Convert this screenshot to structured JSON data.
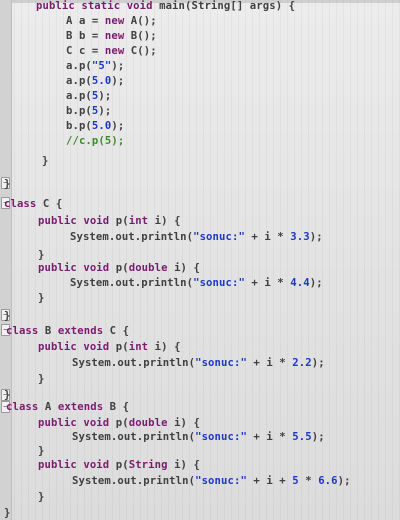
{
  "editor": {
    "lines": [
      {
        "tokens": [
          {
            "t": "public static void ",
            "c": "kw"
          },
          {
            "t": "main(String[] args) {",
            "c": "plain"
          }
        ]
      },
      {
        "tokens": [
          {
            "t": "A a = ",
            "c": "plain"
          },
          {
            "t": "new ",
            "c": "kw"
          },
          {
            "t": "A();",
            "c": "plain"
          }
        ]
      },
      {
        "tokens": [
          {
            "t": "B b = ",
            "c": "plain"
          },
          {
            "t": "new ",
            "c": "kw"
          },
          {
            "t": "B();",
            "c": "plain"
          }
        ]
      },
      {
        "tokens": [
          {
            "t": "C c = ",
            "c": "plain"
          },
          {
            "t": "new ",
            "c": "kw"
          },
          {
            "t": "C();",
            "c": "plain"
          }
        ]
      },
      {
        "tokens": [
          {
            "t": "a.p(",
            "c": "plain"
          },
          {
            "t": "\"5\"",
            "c": "str"
          },
          {
            "t": ");",
            "c": "plain"
          }
        ]
      },
      {
        "tokens": [
          {
            "t": "a.p(",
            "c": "plain"
          },
          {
            "t": "5.0",
            "c": "num"
          },
          {
            "t": ");",
            "c": "plain"
          }
        ]
      },
      {
        "tokens": [
          {
            "t": "a.p(",
            "c": "plain"
          },
          {
            "t": "5",
            "c": "num"
          },
          {
            "t": ");",
            "c": "plain"
          }
        ]
      },
      {
        "tokens": [
          {
            "t": "b.p(",
            "c": "plain"
          },
          {
            "t": "5",
            "c": "num"
          },
          {
            "t": ");",
            "c": "plain"
          }
        ]
      },
      {
        "tokens": [
          {
            "t": "b.p(",
            "c": "plain"
          },
          {
            "t": "5.0",
            "c": "num"
          },
          {
            "t": ");",
            "c": "plain"
          }
        ]
      },
      {
        "tokens": [
          {
            "t": "//c.p(5);",
            "c": "cmt"
          }
        ]
      },
      {
        "tokens": [
          {
            "t": "}",
            "c": "plain"
          }
        ]
      },
      {
        "tokens": [
          {
            "t": "}",
            "c": "plain"
          }
        ]
      },
      {
        "tokens": [
          {
            "t": "class ",
            "c": "kw"
          },
          {
            "t": "C {",
            "c": "plain"
          }
        ]
      },
      {
        "tokens": [
          {
            "t": "public void ",
            "c": "kw"
          },
          {
            "t": "p(",
            "c": "plain"
          },
          {
            "t": "int ",
            "c": "kw"
          },
          {
            "t": "i) {",
            "c": "plain"
          }
        ]
      },
      {
        "tokens": [
          {
            "t": "System.out.println(",
            "c": "plain"
          },
          {
            "t": "\"sonuc:\"",
            "c": "str"
          },
          {
            "t": " + i * ",
            "c": "plain"
          },
          {
            "t": "3.3",
            "c": "num"
          },
          {
            "t": ");",
            "c": "plain"
          }
        ]
      },
      {
        "tokens": [
          {
            "t": "}",
            "c": "plain"
          }
        ]
      },
      {
        "tokens": [
          {
            "t": "public void ",
            "c": "kw"
          },
          {
            "t": "p(",
            "c": "plain"
          },
          {
            "t": "double ",
            "c": "kw"
          },
          {
            "t": "i) {",
            "c": "plain"
          }
        ]
      },
      {
        "tokens": [
          {
            "t": "System.out.println(",
            "c": "plain"
          },
          {
            "t": "\"sonuc:\"",
            "c": "str"
          },
          {
            "t": " + i * ",
            "c": "plain"
          },
          {
            "t": "4.4",
            "c": "num"
          },
          {
            "t": ");",
            "c": "plain"
          }
        ]
      },
      {
        "tokens": [
          {
            "t": "}",
            "c": "plain"
          }
        ]
      },
      {
        "tokens": [
          {
            "t": "}",
            "c": "plain"
          }
        ]
      },
      {
        "tokens": [
          {
            "t": "class ",
            "c": "kw"
          },
          {
            "t": "B ",
            "c": "plain"
          },
          {
            "t": "extends ",
            "c": "kw"
          },
          {
            "t": "C {",
            "c": "plain"
          }
        ]
      },
      {
        "tokens": [
          {
            "t": "public void ",
            "c": "kw"
          },
          {
            "t": "p(",
            "c": "plain"
          },
          {
            "t": "int ",
            "c": "kw"
          },
          {
            "t": "i) {",
            "c": "plain"
          }
        ]
      },
      {
        "tokens": [
          {
            "t": "System.out.println(",
            "c": "plain"
          },
          {
            "t": "\"sonuc:\"",
            "c": "str"
          },
          {
            "t": " + i * ",
            "c": "plain"
          },
          {
            "t": "2.2",
            "c": "num"
          },
          {
            "t": ");",
            "c": "plain"
          }
        ]
      },
      {
        "tokens": [
          {
            "t": "}",
            "c": "plain"
          }
        ]
      },
      {
        "tokens": [
          {
            "t": "}",
            "c": "plain"
          }
        ]
      },
      {
        "tokens": [
          {
            "t": "class ",
            "c": "kw"
          },
          {
            "t": "A ",
            "c": "plain"
          },
          {
            "t": "extends ",
            "c": "kw"
          },
          {
            "t": "B {",
            "c": "plain"
          }
        ]
      },
      {
        "tokens": [
          {
            "t": "public void ",
            "c": "kw"
          },
          {
            "t": "p(",
            "c": "plain"
          },
          {
            "t": "double ",
            "c": "kw"
          },
          {
            "t": "i) {",
            "c": "plain"
          }
        ]
      },
      {
        "tokens": [
          {
            "t": "System.out.println(",
            "c": "plain"
          },
          {
            "t": "\"sonuc:\"",
            "c": "str"
          },
          {
            "t": " + i * ",
            "c": "plain"
          },
          {
            "t": "5.5",
            "c": "num"
          },
          {
            "t": ");",
            "c": "plain"
          }
        ]
      },
      {
        "tokens": [
          {
            "t": "}",
            "c": "plain"
          }
        ]
      },
      {
        "tokens": [
          {
            "t": "public void ",
            "c": "kw"
          },
          {
            "t": "p(",
            "c": "plain"
          },
          {
            "t": "String ",
            "c": "kw"
          },
          {
            "t": "i) {",
            "c": "plain"
          }
        ]
      },
      {
        "tokens": [
          {
            "t": "System.out.println(",
            "c": "plain"
          },
          {
            "t": "\"sonuc:\"",
            "c": "str"
          },
          {
            "t": " + i + ",
            "c": "plain"
          },
          {
            "t": "5",
            "c": "num"
          },
          {
            "t": " * ",
            "c": "plain"
          },
          {
            "t": "6.6",
            "c": "num"
          },
          {
            "t": ");",
            "c": "plain"
          }
        ]
      },
      {
        "tokens": [
          {
            "t": "}",
            "c": "plain"
          }
        ]
      },
      {
        "tokens": [
          {
            "t": "}",
            "c": "plain"
          }
        ]
      }
    ],
    "colors": {
      "keyword": "#7b1b6e",
      "string": "#1e38c6",
      "number": "#1e38c6",
      "comment": "#3f8a2f",
      "text": "#404040",
      "background": "#e6e6e6"
    }
  }
}
